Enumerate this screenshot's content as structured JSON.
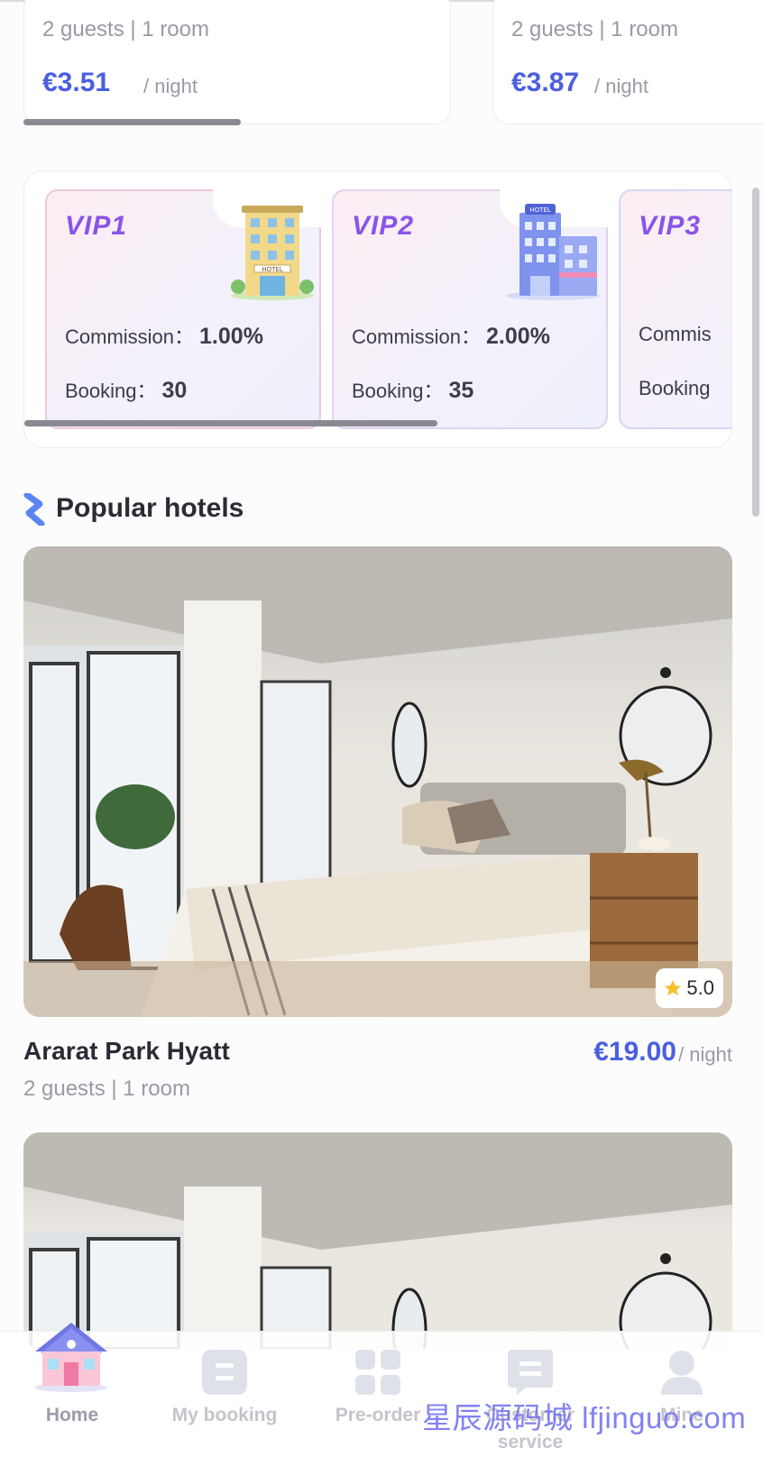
{
  "top_cards": [
    {
      "guests": "2 guests | 1 room",
      "price": "€3.51",
      "per_night": "/ night"
    },
    {
      "guests": "2 guests | 1 room",
      "price": "€3.87",
      "per_night": "/ night"
    }
  ],
  "vip": {
    "cards": [
      {
        "level": "VIP1",
        "commission_label": "Commission：",
        "commission": "1.00%",
        "booking_label": "Booking：",
        "booking": "30"
      },
      {
        "level": "VIP2",
        "commission_label": "Commission：",
        "commission": "2.00%",
        "booking_label": "Booking：",
        "booking": "35"
      },
      {
        "level": "VIP3",
        "commission_label": "Commis",
        "commission": "",
        "booking_label": "Booking",
        "booking": ""
      }
    ],
    "building_icon_sign": "HOTEL"
  },
  "popular": {
    "title": "Popular hotels",
    "hotels": [
      {
        "name": "Ararat Park Hyatt",
        "guests": "2 guests | 1 room",
        "price": "€19.00",
        "per_night": "/ night",
        "rating": "5.0"
      }
    ]
  },
  "nav": {
    "items": [
      {
        "label": "Home",
        "icon": "home-icon",
        "active": true
      },
      {
        "label": "My booking",
        "icon": "booking-icon",
        "active": false
      },
      {
        "label": "Pre-order",
        "icon": "grid-icon",
        "active": false
      },
      {
        "label": "Customer service",
        "icon": "chat-icon",
        "active": false
      },
      {
        "label": "Mine",
        "icon": "user-icon",
        "active": false
      }
    ]
  },
  "watermark": "星辰源码城 lfjinguo.com",
  "colors": {
    "accent": "#4a5fe0",
    "vip_title": "#8a54e8"
  }
}
